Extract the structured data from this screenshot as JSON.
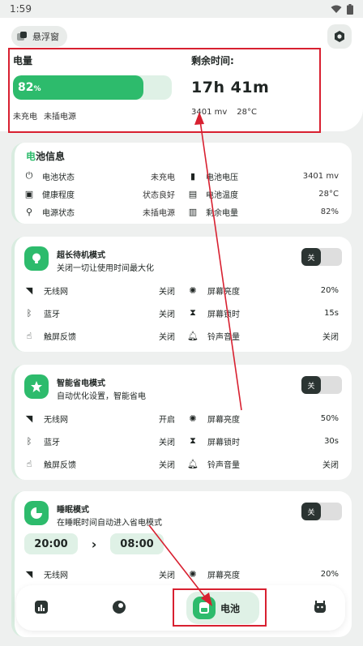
{
  "status_bar": {
    "time": "1:59"
  },
  "header": {
    "float_window_label": "悬浮窗"
  },
  "battery": {
    "level_label": "电量",
    "level_percent": 82,
    "level_value": "82",
    "level_unit": "%",
    "charging_state": "未充电",
    "power_source": "未插电源",
    "remaining_label": "剩余时间:",
    "remaining_time": "17h 41m",
    "voltage": "3401 mv",
    "temperature": "28°C"
  },
  "info_card": {
    "title_prefix": "电",
    "title_rest": "池信息",
    "rows": [
      {
        "left": {
          "label": "电池状态",
          "value": "未充电"
        },
        "right": {
          "label": "电池电压",
          "value": "3401 mv"
        }
      },
      {
        "left": {
          "label": "健康程度",
          "value": "状态良好"
        },
        "right": {
          "label": "电池温度",
          "value": "28°C"
        }
      },
      {
        "left": {
          "label": "电源状态",
          "value": "未插电源"
        },
        "right": {
          "label": "剩余电量",
          "value": "82%"
        }
      }
    ]
  },
  "mode_standby": {
    "title": "超长待机模式",
    "subtitle": "关闭一切让使用时间最大化",
    "toggle": "关",
    "rows": [
      {
        "left": {
          "label": "无线网",
          "value": "关闭"
        },
        "right": {
          "label": "屏幕亮度",
          "value": "20%"
        }
      },
      {
        "left": {
          "label": "蓝牙",
          "value": "关闭"
        },
        "right": {
          "label": "屏幕锁时",
          "value": "15s"
        }
      },
      {
        "left": {
          "label": "触屏反馈",
          "value": "关闭"
        },
        "right": {
          "label": "铃声音量",
          "value": "关闭"
        }
      }
    ]
  },
  "mode_smart": {
    "title": "智能省电模式",
    "subtitle": "自动优化设置，智能省电",
    "toggle": "关",
    "rows": [
      {
        "left": {
          "label": "无线网",
          "value": "开启"
        },
        "right": {
          "label": "屏幕亮度",
          "value": "50%"
        }
      },
      {
        "left": {
          "label": "蓝牙",
          "value": "关闭"
        },
        "right": {
          "label": "屏幕锁时",
          "value": "30s"
        }
      },
      {
        "left": {
          "label": "触屏反馈",
          "value": "关闭"
        },
        "right": {
          "label": "铃声音量",
          "value": "关闭"
        }
      }
    ]
  },
  "mode_sleep": {
    "title": "睡眠模式",
    "subtitle": "在睡眠时间自动进入省电模式",
    "toggle": "关",
    "start_time": "20:00",
    "end_time": "08:00",
    "rows": [
      {
        "left": {
          "label": "无线网",
          "value": "关闭"
        },
        "right": {
          "label": "屏幕亮度",
          "value": "20%"
        }
      }
    ]
  },
  "bottom_nav": {
    "active_label": "电池"
  },
  "colors": {
    "accent": "#2dbb6c",
    "accent_light": "#dff1e6",
    "annotation": "#d82030"
  }
}
